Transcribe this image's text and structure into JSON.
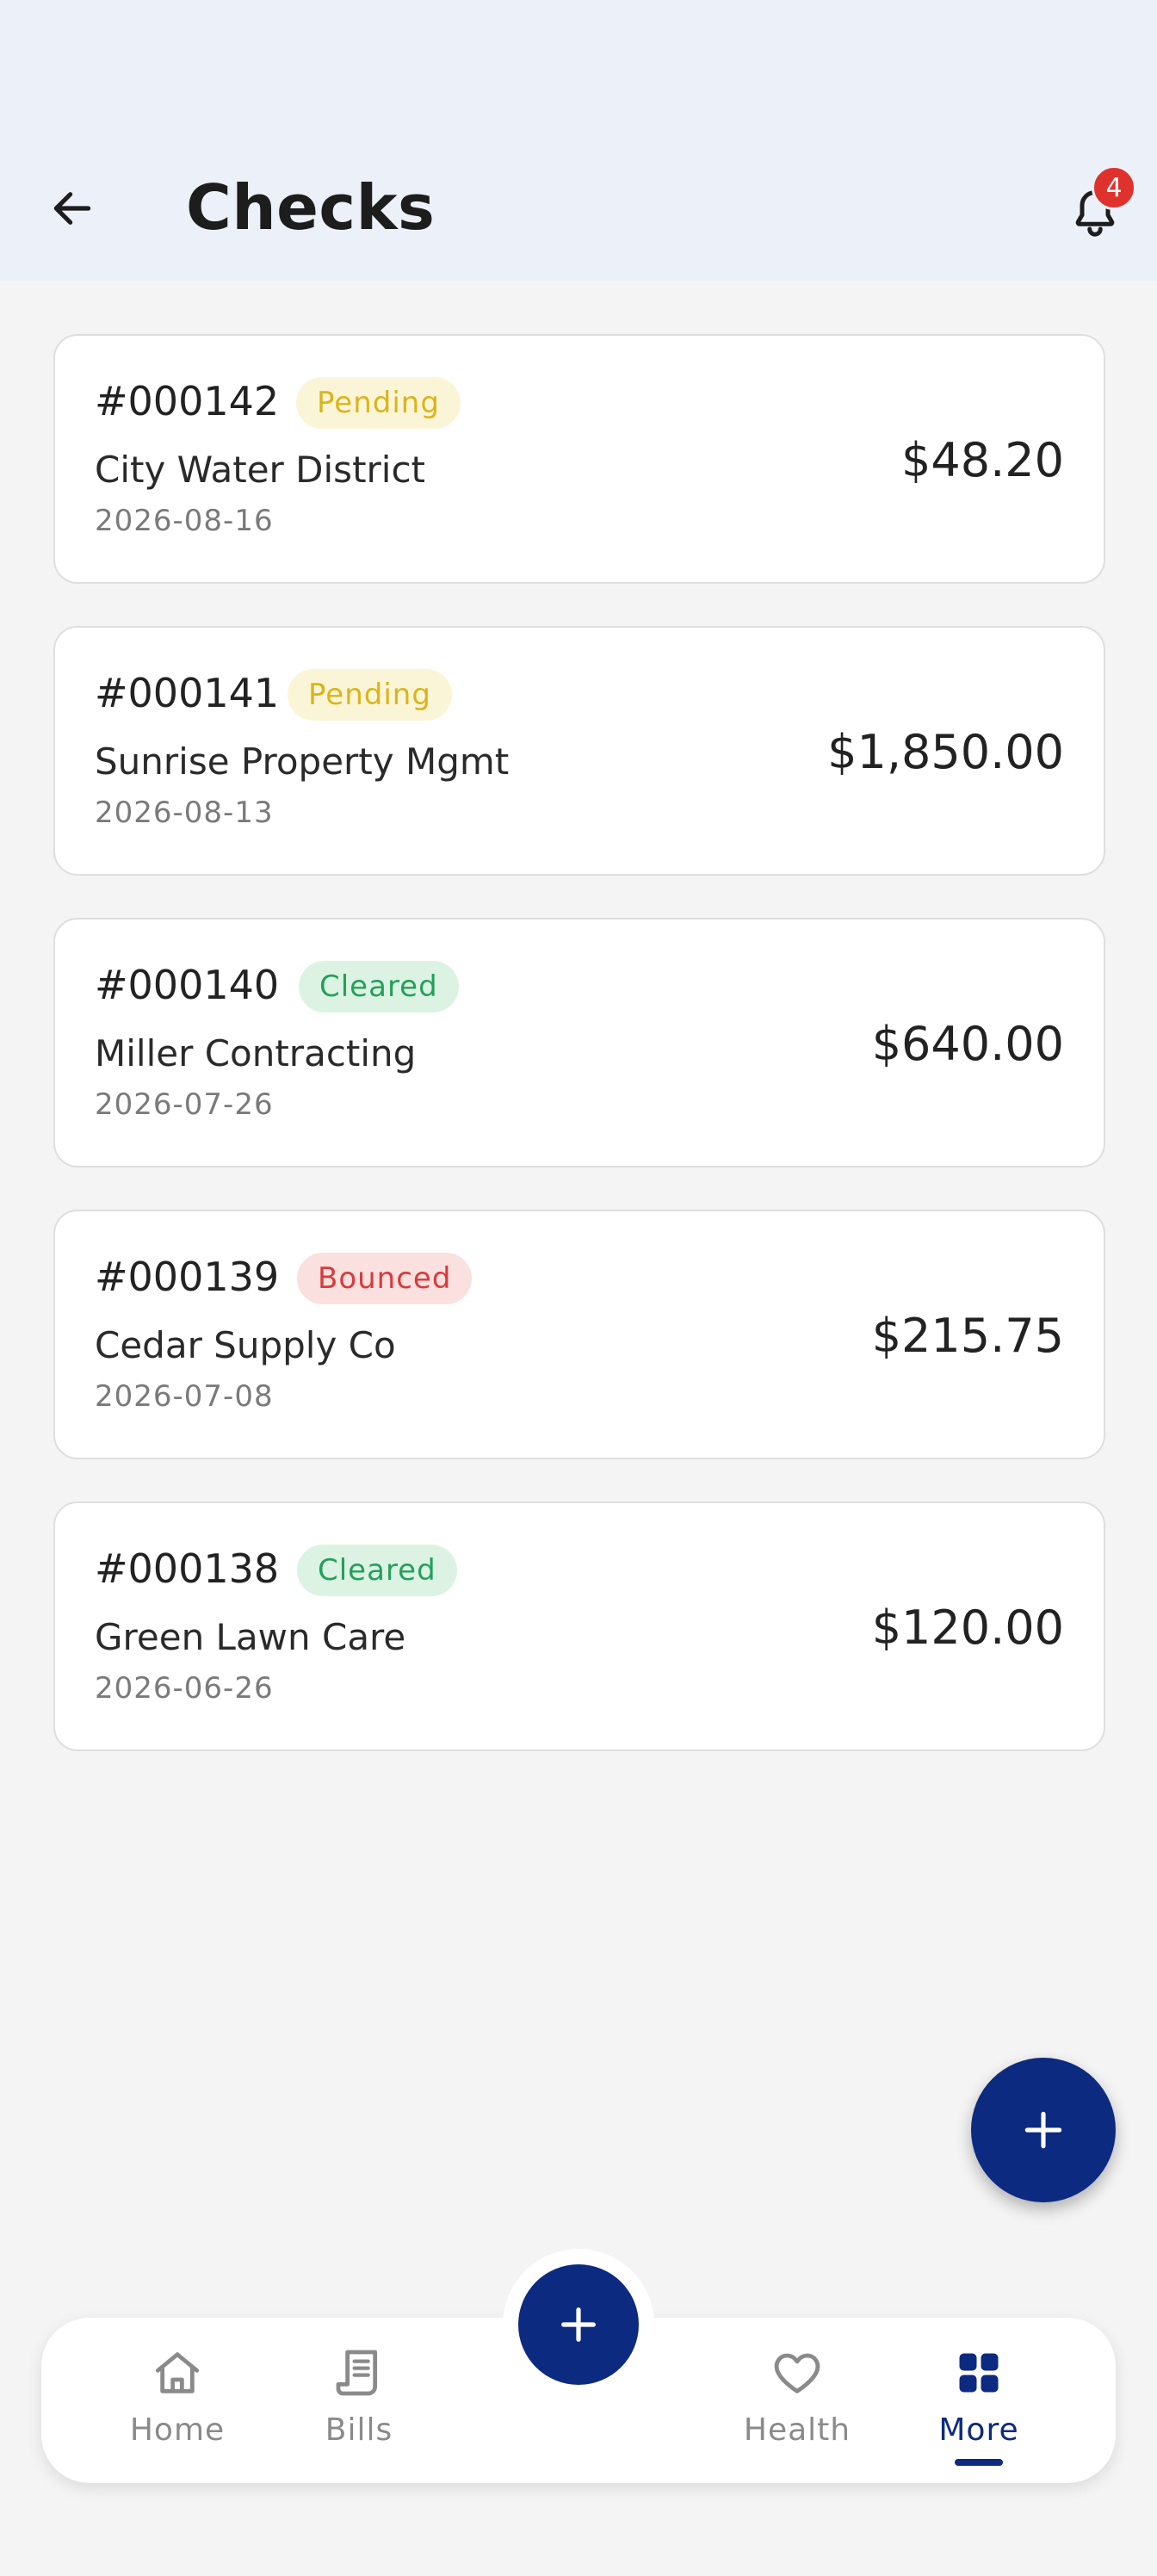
{
  "header": {
    "title": "Checks",
    "back_icon": "arrow-left-icon",
    "notification_icon": "bell-icon",
    "notification_count": "4"
  },
  "checks": [
    {
      "number": "#000142",
      "status": "Pending",
      "payee": "City Water District",
      "date": "2026-08-16",
      "amount": "$48.20"
    },
    {
      "number": "#000141",
      "status": "Pending",
      "payee": "Sunrise Property Mgmt",
      "date": "2026-08-13",
      "amount": "$1,850.00"
    },
    {
      "number": "#000140",
      "status": "Cleared",
      "payee": "Miller Contracting",
      "date": "2026-07-26",
      "amount": "$640.00"
    },
    {
      "number": "#000139",
      "status": "Bounced",
      "payee": "Cedar Supply Co",
      "date": "2026-07-08",
      "amount": "$215.75"
    },
    {
      "number": "#000138",
      "status": "Cleared",
      "payee": "Green Lawn Care",
      "date": "2026-06-26",
      "amount": "$120.00"
    }
  ],
  "status_colors": {
    "pending": {
      "bg": "#fbf5d8",
      "fg": "#dcb419"
    },
    "cleared": {
      "bg": "#dcf3e4",
      "fg": "#23a05a"
    },
    "bounced": {
      "bg": "#fbe0e0",
      "fg": "#d93a3a"
    }
  },
  "fab": {
    "icon": "plus-icon"
  },
  "bottom_nav": {
    "items": [
      {
        "label": "Home",
        "icon": "home-icon",
        "active": false
      },
      {
        "label": "Bills",
        "icon": "receipt-icon",
        "active": false
      },
      {
        "label": "Health",
        "icon": "heart-icon",
        "active": false
      },
      {
        "label": "More",
        "icon": "grid-icon",
        "active": true
      }
    ],
    "center_icon": "plus-icon"
  },
  "colors": {
    "accent": "#0c2a80",
    "header_bg": "#ecf1f9",
    "page_bg": "#f4f4f4",
    "badge_red": "#e0322d"
  }
}
